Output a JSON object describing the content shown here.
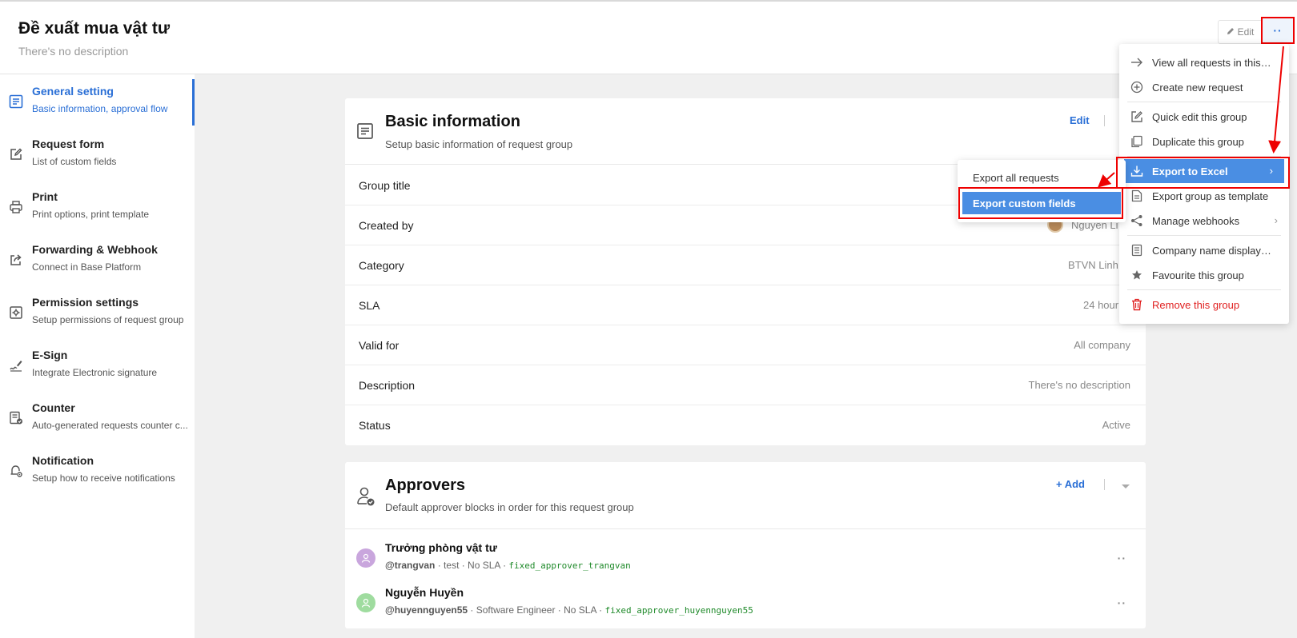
{
  "header": {
    "title": "Đề xuất mua vật tư",
    "description": "There's no description",
    "edit_label": "Edit",
    "more_label": "··"
  },
  "sidebar": {
    "items": [
      {
        "title": "General setting",
        "subtitle": "Basic information, approval flow",
        "icon": "list-doc-icon"
      },
      {
        "title": "Request form",
        "subtitle": "List of custom fields",
        "icon": "edit-form-icon"
      },
      {
        "title": "Print",
        "subtitle": "Print options, print template",
        "icon": "printer-icon"
      },
      {
        "title": "Forwarding & Webhook",
        "subtitle": "Connect in Base Platform",
        "icon": "share-icon"
      },
      {
        "title": "Permission settings",
        "subtitle": "Setup permissions of request group",
        "icon": "gear-shield-icon"
      },
      {
        "title": "E-Sign",
        "subtitle": "Integrate Electronic signature",
        "icon": "signature-icon"
      },
      {
        "title": "Counter",
        "subtitle": "Auto-generated requests counter c...",
        "icon": "counter-icon"
      },
      {
        "title": "Notification",
        "subtitle": "Setup how to receive notifications",
        "icon": "bell-gear-icon"
      }
    ]
  },
  "basic_info": {
    "title": "Basic information",
    "description": "Setup basic information of request group",
    "edit_label": "Edit",
    "rows": [
      {
        "label": "Group title",
        "value": ""
      },
      {
        "label": "Created by",
        "value": "Nguyễn Li"
      },
      {
        "label": "Category",
        "value": "BTVN Linh"
      },
      {
        "label": "SLA",
        "value": "24 hour"
      },
      {
        "label": "Valid for",
        "value": "All company"
      },
      {
        "label": "Description",
        "value": "There's no description"
      },
      {
        "label": "Status",
        "value": "Active"
      }
    ]
  },
  "approvers": {
    "title": "Approvers",
    "description": "Default approver blocks in order for this request group",
    "add_label": "+ Add",
    "items": [
      {
        "name": "Trưởng phòng vật tư",
        "username": "@trangvan",
        "meta": " · test · No SLA · ",
        "code": "fixed_approver_trangvan",
        "avatar_color": "#c9a6dd"
      },
      {
        "name": "Nguyễn Huyền",
        "username": "@huyennguyen55",
        "meta": " · Software Engineer · No SLA · ",
        "code": "fixed_approver_huyennguyen55",
        "avatar_color": "#9fdc9f"
      }
    ]
  },
  "more_menu": {
    "items": [
      {
        "label": "View all requests in this ...",
        "icon": "arrow-right-icon"
      },
      {
        "label": "Create new request",
        "icon": "plus-circle-icon"
      },
      {
        "label": "Quick edit this group",
        "icon": "edit-icon"
      },
      {
        "label": "Duplicate this group",
        "icon": "copy-icon"
      },
      {
        "label": "Export to Excel",
        "icon": "download-icon"
      },
      {
        "label": "Export group as template",
        "icon": "file-icon"
      },
      {
        "label": "Manage webhooks",
        "icon": "share-nodes-icon"
      },
      {
        "label": "Company name display ...",
        "icon": "document-icon"
      },
      {
        "label": "Favourite this group",
        "icon": "star-icon"
      },
      {
        "label": "Remove this group",
        "icon": "trash-icon"
      }
    ]
  },
  "export_submenu": {
    "items": [
      {
        "label": "Export all requests"
      },
      {
        "label": "Export custom fields"
      }
    ]
  },
  "colors": {
    "accent": "#2a6fd6",
    "highlight": "#4a8ee3",
    "annotation_red": "#e00000",
    "danger": "#e02020"
  }
}
